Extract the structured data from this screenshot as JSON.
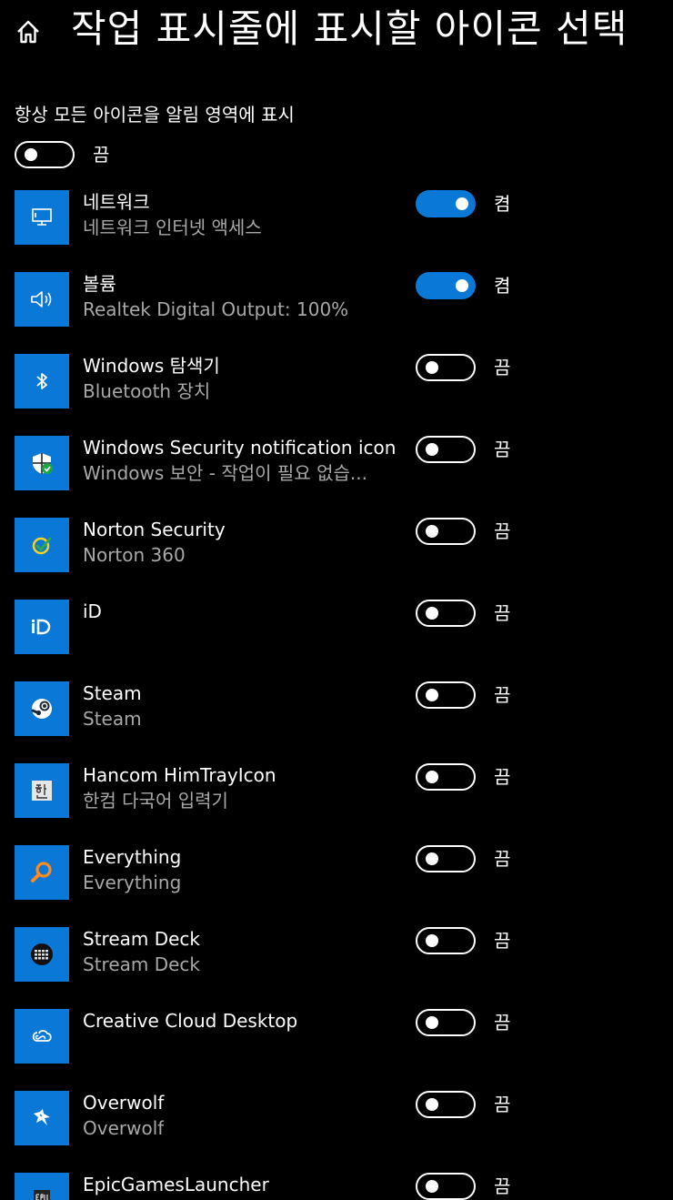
{
  "header": {
    "title": "작업 표시줄에 표시할 아이콘 선택"
  },
  "always_show": {
    "label": "항상 모든 아이콘을 알림 영역에 표시",
    "state": "끔"
  },
  "rows": [
    {
      "icon": "network-icon",
      "name": "네트워크",
      "sub": "네트워크 인터넷 액세스",
      "state": "켬",
      "on": true
    },
    {
      "icon": "volume-icon",
      "name": "볼륨",
      "sub": "Realtek Digital Output: 100%",
      "state": "켬",
      "on": true
    },
    {
      "icon": "bluetooth-icon",
      "name": "Windows 탐색기",
      "sub": "Bluetooth 장치",
      "state": "끔",
      "on": false
    },
    {
      "icon": "shield-icon",
      "name": "Windows Security notification icon",
      "sub": "Windows 보안 - 작업이 필요 없습...",
      "state": "끔",
      "on": false
    },
    {
      "icon": "norton-icon",
      "name": "Norton Security",
      "sub": "Norton 360",
      "state": "끔",
      "on": false
    },
    {
      "icon": "id-icon",
      "name": "iD",
      "sub": "",
      "state": "끔",
      "on": false
    },
    {
      "icon": "steam-icon",
      "name": "Steam",
      "sub": "Steam",
      "state": "끔",
      "on": false
    },
    {
      "icon": "hancom-icon",
      "name": "Hancom HimTrayIcon",
      "sub": "한컴 다국어 입력기",
      "state": "끔",
      "on": false
    },
    {
      "icon": "magnifier-icon",
      "name": "Everything",
      "sub": "Everything",
      "state": "끔",
      "on": false
    },
    {
      "icon": "stream-deck-icon",
      "name": "Stream Deck",
      "sub": "Stream Deck",
      "state": "끔",
      "on": false
    },
    {
      "icon": "creative-cloud-icon",
      "name": "Creative Cloud Desktop",
      "sub": "",
      "state": "끔",
      "on": false
    },
    {
      "icon": "overwolf-icon",
      "name": "Overwolf",
      "sub": "Overwolf",
      "state": "끔",
      "on": false
    },
    {
      "icon": "epic-games-icon",
      "name": "EpicGamesLauncher",
      "sub": "",
      "state": "끔",
      "on": false
    }
  ],
  "colors": {
    "accent": "#0a78d7",
    "background": "#000000",
    "secondary_text": "#a8a8a8"
  }
}
